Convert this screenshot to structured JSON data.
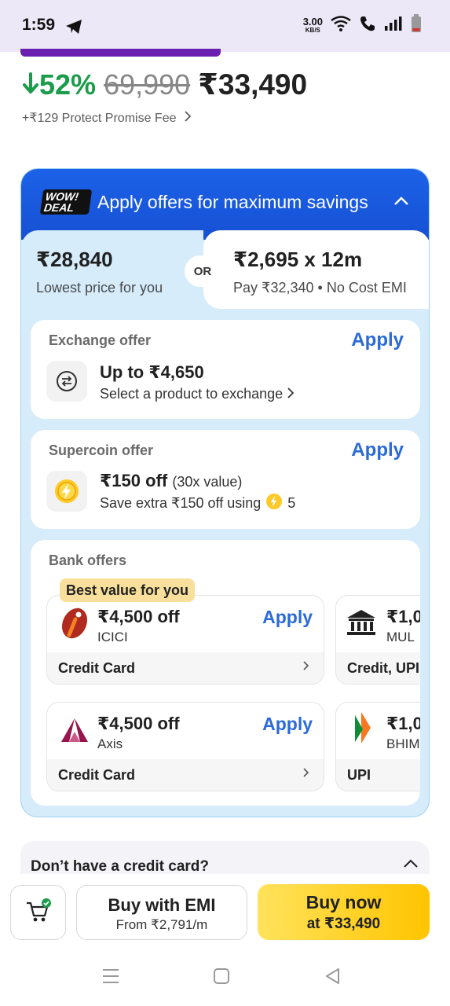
{
  "status_bar": {
    "time": "1:59",
    "speed": "3.00",
    "speed_unit": "KB/S"
  },
  "product": {
    "discount": "52%",
    "mrp": "69,990",
    "price": "₹33,490",
    "protect_fee": "+₹129 Protect Promise Fee"
  },
  "offers": {
    "badge_line1": "WOW!",
    "badge_line2": "DEAL",
    "title": "Apply offers for maximum savings",
    "lowest_price": "₹28,840",
    "lowest_label": "Lowest price for you",
    "or": "OR",
    "emi_amount": "₹2,695 x 12m",
    "emi_label": "Pay ₹32,340 • No Cost EMI",
    "exchange": {
      "title": "Exchange offer",
      "apply": "Apply",
      "main": "Up to ₹4,650",
      "sub": "Select a product to exchange"
    },
    "supercoin": {
      "title": "Supercoin offer",
      "apply": "Apply",
      "main": "₹150 off",
      "main_extra": "(30x value)",
      "sub": "Save extra ₹150 off using",
      "coins": "5"
    },
    "bank": {
      "title": "Bank offers",
      "best_badge": "Best value for you",
      "cards": [
        {
          "amount": "₹4,500 off",
          "bank": "ICICI",
          "apply": "Apply",
          "type": "Credit Card"
        },
        {
          "amount": "₹1,0",
          "bank": "MUL",
          "type": "Credit, UPI"
        },
        {
          "amount": "₹4,500 off",
          "bank": "Axis",
          "apply": "Apply",
          "type": "Credit Card"
        },
        {
          "amount": "₹1,0",
          "bank": "BHIM",
          "type": "UPI"
        }
      ]
    }
  },
  "no_credit_card": {
    "title": "Don’t have a credit card?"
  },
  "bottom_bar": {
    "emi_title": "Buy with EMI",
    "emi_sub": "From ₹2,791/m",
    "buy_title": "Buy now",
    "buy_sub": "at ₹33,490"
  },
  "icons": [
    "telegram-icon",
    "wifi-icon",
    "call-icon",
    "signal-icon",
    "battery-icon",
    "down-arrow-icon",
    "chevron-right-icon",
    "chevron-up-icon",
    "exchange-icon",
    "supercoin-icon",
    "icici-logo-icon",
    "bank-building-icon",
    "axis-logo-icon",
    "bhim-logo-icon",
    "cart-icon",
    "menu-icon",
    "home-icon",
    "back-icon"
  ]
}
